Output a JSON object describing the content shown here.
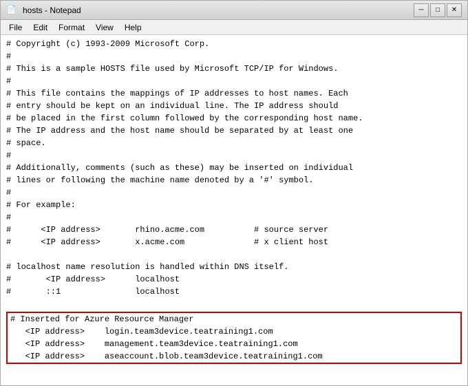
{
  "window": {
    "title": "hosts - Notepad",
    "icon": "📄"
  },
  "titlebar": {
    "text": "hosts - Notepad",
    "minimize_label": "─",
    "maximize_label": "□",
    "close_label": "✕"
  },
  "menubar": {
    "items": [
      {
        "label": "File",
        "id": "file"
      },
      {
        "label": "Edit",
        "id": "edit"
      },
      {
        "label": "Format",
        "id": "format"
      },
      {
        "label": "View",
        "id": "view"
      },
      {
        "label": "Help",
        "id": "help"
      }
    ]
  },
  "content": {
    "lines": [
      "# Copyright (c) 1993-2009 Microsoft Corp.",
      "#",
      "# This is a sample HOSTS file used by Microsoft TCP/IP for Windows.",
      "#",
      "# This file contains the mappings of IP addresses to host names. Each",
      "# entry should be kept on an individual line. The IP address should",
      "# be placed in the first column followed by the corresponding host name.",
      "# The IP address and the host name should be separated by at least one",
      "# space.",
      "#",
      "# Additionally, comments (such as these) may be inserted on individual",
      "# lines or following the machine name denoted by a '#' symbol.",
      "#",
      "# For example:",
      "#",
      "#      <IP address>       rhino.acme.com          # source server",
      "#      <IP address>       x.acme.com              # x client host",
      "",
      "# localhost name resolution is handled within DNS itself.",
      "#       <IP address>      localhost",
      "#       ::1               localhost"
    ],
    "highlighted_lines": [
      "# Inserted for Azure Resource Manager",
      "   <IP address>    login.team3device.teatraining1.com",
      "   <IP address>    management.team3device.teatraining1.com",
      "   <IP address>    aseaccount.blob.team3device.teatraining1.com"
    ]
  }
}
